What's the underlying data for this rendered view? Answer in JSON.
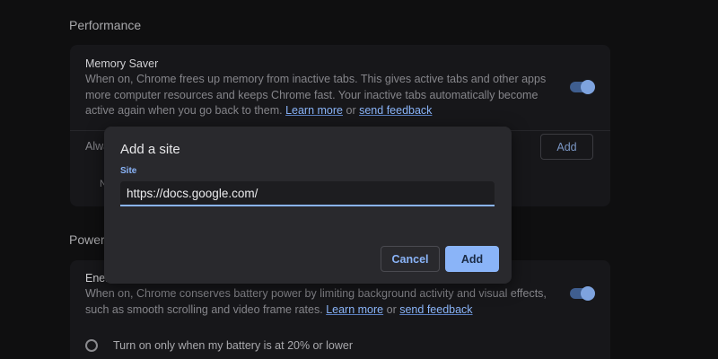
{
  "performance": {
    "section_title": "Performance",
    "memory_saver": {
      "title": "Memory Saver",
      "description": "When on, Chrome frees up memory from inactive tabs. This gives active tabs and other apps more computer resources and keeps Chrome fast. Your inactive tabs automatically become active again when you go back to them.",
      "learn_more": "Learn more",
      "or_text": "or",
      "feedback": "send feedback",
      "toggle_on": true
    },
    "always_row_partial": "Alwa",
    "row_partial_n": "N",
    "add_button": "Add"
  },
  "power": {
    "section_title_partial": "Power",
    "energy_saver": {
      "title_partial": "Ener",
      "description": "When on, Chrome conserves battery power by limiting background activity and visual effects, such as smooth scrolling and video frame rates.",
      "learn_more": "Learn more",
      "or_text": "or",
      "feedback": "send feedback",
      "toggle_on": true
    },
    "radio_option": "Turn on only when my battery is at 20% or lower"
  },
  "dialog": {
    "title": "Add a site",
    "field_label": "Site",
    "field_value": "https://docs.google.com/",
    "cancel": "Cancel",
    "add": "Add"
  },
  "colors": {
    "accent": "#8ab4f8",
    "background": "#0f0f10",
    "dialog": "#29292d"
  }
}
